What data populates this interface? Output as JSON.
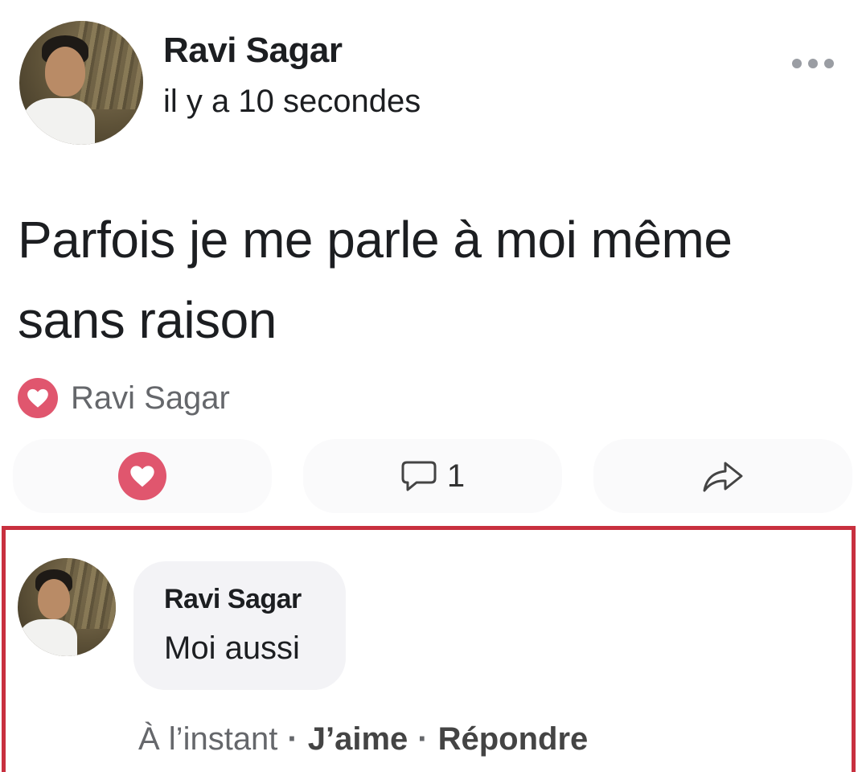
{
  "post": {
    "author": "Ravi Sagar",
    "time": "il y a 10 secondes",
    "text": "Parfois je me parle à moi même\nsans raison",
    "reactor_name": "Ravi Sagar",
    "comment_count": "1"
  },
  "comment": {
    "author": "Ravi Sagar",
    "text": "Moi aussi",
    "time": "À l’instant",
    "like_label": "J’aime",
    "reply_label": "Répondre",
    "separator": "·"
  },
  "icons": {
    "more": "more-horizontal-icon",
    "reaction": "heart-icon",
    "comment": "comment-bubble-icon",
    "share": "share-arrow-icon"
  },
  "colors": {
    "heart": "#e0566e",
    "highlight_border": "#c8303f",
    "secondary_text": "#65676b"
  }
}
